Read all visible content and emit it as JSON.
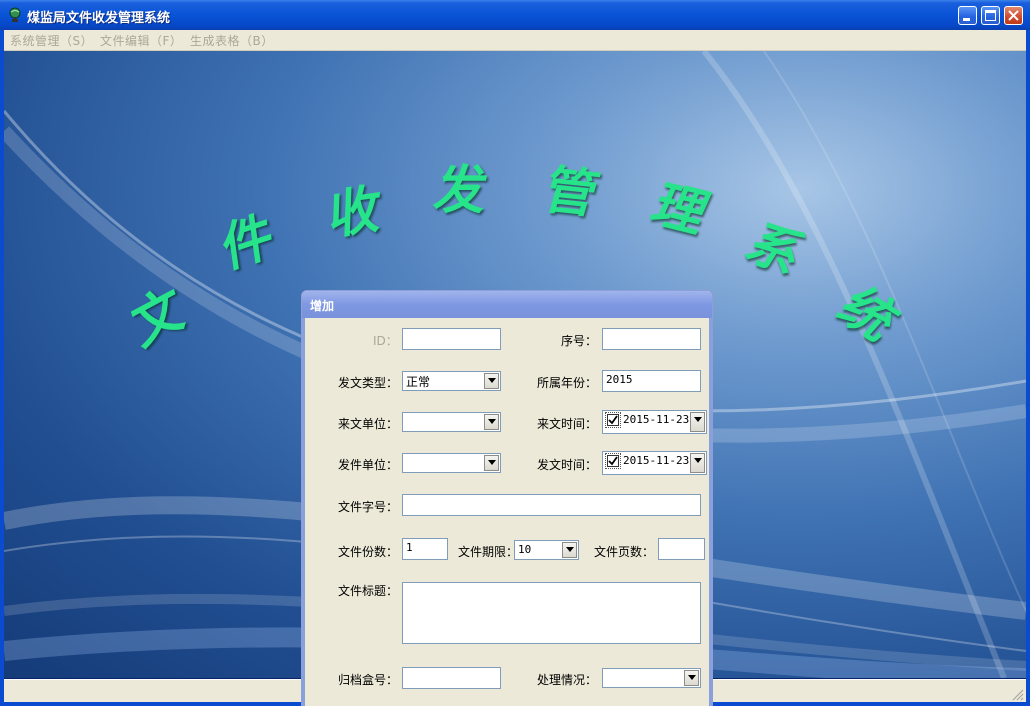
{
  "window": {
    "title": "煤监局文件收发管理系统"
  },
  "menu": [
    {
      "label": "系统管理（S）"
    },
    {
      "label": "文件编辑（F）"
    },
    {
      "label": "生成表格（B）"
    }
  ],
  "background_title": [
    "文",
    "件",
    "收",
    "发",
    "管",
    "理",
    "系",
    "统"
  ],
  "dialog": {
    "title": "增加",
    "id_label": "ID：",
    "id_value": "",
    "seq_label": "序号：",
    "seq_value": "",
    "doc_type_label": "发文类型：",
    "doc_type_value": "正常",
    "year_label": "所属年份：",
    "year_value": "2015",
    "from_unit_label": "来文单位：",
    "from_unit_value": "",
    "received_time_label": "来文时间：",
    "received_time_value": "2015-11-23",
    "received_time_checked": true,
    "send_unit_label": "发件单位：",
    "send_unit_value": "",
    "send_time_label": "发文时间：",
    "send_time_value": "2015-11-23",
    "send_time_checked": true,
    "doc_number_label": "文件字号：",
    "doc_number_value": "",
    "copies_label": "文件份数：",
    "copies_value": "1",
    "term_label": "文件期限：",
    "term_value": "10",
    "pages_label": "文件页数：",
    "pages_value": "",
    "doc_title_label": "文件标题：",
    "doc_title_value": "",
    "archive_label": "归档盒号：",
    "archive_value": "",
    "status_label": "处理情况：",
    "status_value": ""
  },
  "colors": {
    "titlebar": "#0b55d8",
    "background_text": "#27e38a",
    "dialog_face": "#ece9d8"
  }
}
